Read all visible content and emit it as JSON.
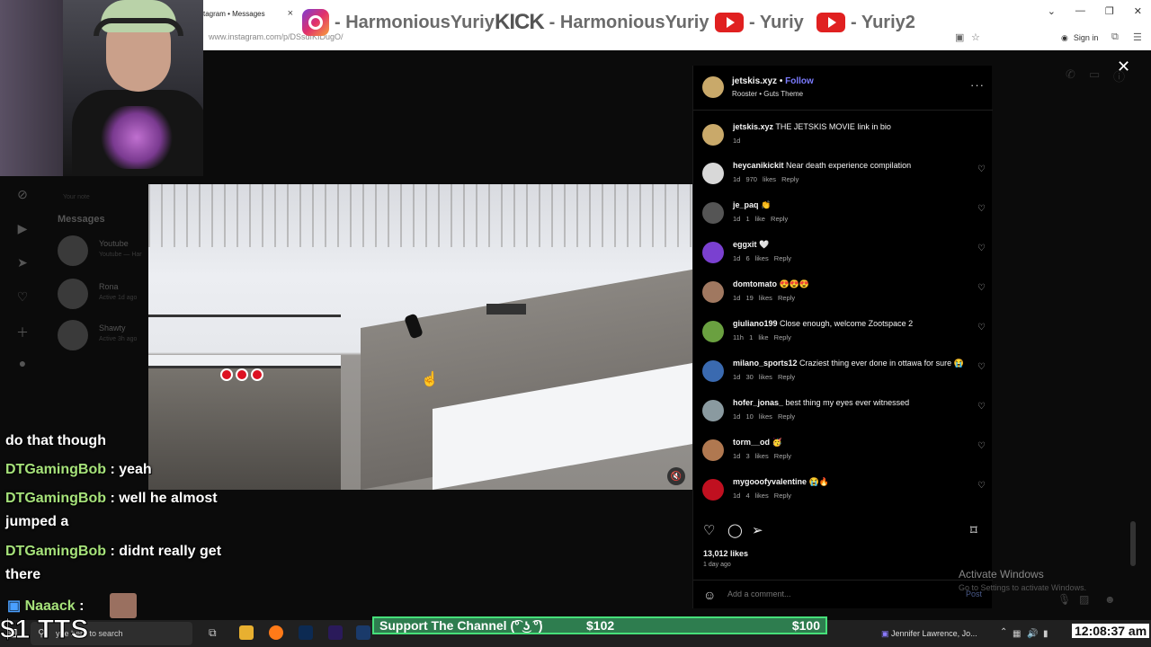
{
  "browser": {
    "tab_title": "tagram • Messages",
    "tab_close": "×",
    "url": "www.instagram.com/p/DSsdfKIDugO/",
    "sign_in": "Sign in"
  },
  "banner": {
    "items": [
      {
        "platform": "instagram",
        "text": "- HarmoniousYuriy"
      },
      {
        "platform": "kick",
        "logo": "KICK",
        "text": "- HarmoniousYuriy"
      },
      {
        "platform": "youtube",
        "text": "- Yuriy"
      },
      {
        "platform": "youtube",
        "text": "- Yuriy2"
      }
    ]
  },
  "sidebar": {
    "your_note": "Your note",
    "messages_title": "Messages",
    "conversations": [
      {
        "name": "Youtube",
        "sub": "Youtube — Har"
      },
      {
        "name": "Rona",
        "sub": "Active 1d ago"
      },
      {
        "name": "Shawty",
        "sub": "Active 3h ago"
      }
    ]
  },
  "post": {
    "username": "jetskis.xyz",
    "follow": "Follow",
    "music": "Rooster • Guts Theme",
    "more": "···",
    "likes": "13,012 likes",
    "posted": "1 day ago",
    "add_comment_placeholder": "Add a comment...",
    "post_label": "Post",
    "comments": [
      {
        "user": "jetskis.xyz",
        "text": "THE JETSKIS MOVIE link in bio",
        "time": "1d",
        "likes": "",
        "reply": "",
        "avatar_color": "#c9a96a"
      },
      {
        "user": "heycanikickit",
        "text": "Near death experience compilation",
        "time": "1d",
        "likes": "970 likes",
        "reply": "Reply",
        "avatar_color": "#d8d8d8"
      },
      {
        "user": "je_paq",
        "text": "👏",
        "time": "1d",
        "likes": "1 like",
        "reply": "Reply",
        "avatar_color": "#555555"
      },
      {
        "user": "eggxit",
        "text": "🤍",
        "time": "1d",
        "likes": "6 likes",
        "reply": "Reply",
        "avatar_color": "#7a40d0"
      },
      {
        "user": "domtomato",
        "text": "😍😍😍",
        "time": "1d",
        "likes": "19 likes",
        "reply": "Reply",
        "avatar_color": "#a07860"
      },
      {
        "user": "giuliano199",
        "text": "Close enough, welcome Zootspace 2",
        "time": "11h",
        "likes": "1 like",
        "reply": "Reply",
        "avatar_color": "#6aa040"
      },
      {
        "user": "milano_sports12",
        "text": "Craziest thing ever done in ottawa for sure 😭",
        "time": "1d",
        "likes": "30 likes",
        "reply": "Reply",
        "avatar_color": "#3a6ab0"
      },
      {
        "user": "hofer_jonas_",
        "text": "best thing my eyes ever witnessed",
        "time": "1d",
        "likes": "10 likes",
        "reply": "Reply",
        "avatar_color": "#8a9aa0"
      },
      {
        "user": "torm__od",
        "text": "🥳",
        "time": "1d",
        "likes": "3 likes",
        "reply": "Reply",
        "avatar_color": "#b07850"
      },
      {
        "user": "mygooofyvalentine",
        "text": "😭🔥",
        "time": "1d",
        "likes": "4 likes",
        "reply": "Reply",
        "avatar_color": "#c01020"
      }
    ]
  },
  "windows_notice": {
    "line1": "Activate Windows",
    "line2": "Go to Settings to activate Windows."
  },
  "chat": {
    "lines": [
      {
        "user": "",
        "text": "do that though"
      },
      {
        "user": "DTGamingBob",
        "text": " : yeah"
      },
      {
        "user": "DTGamingBob",
        "text": " : well he almost"
      },
      {
        "user": "",
        "text": "jumped a"
      },
      {
        "user": "DTGamingBob",
        "text": " : didnt really get"
      },
      {
        "user": "",
        "text": "there"
      }
    ],
    "last_user": "Naaack",
    "last_sep": ":",
    "tts": "$1 TTS"
  },
  "taskbar": {
    "search_placeholder": "ype here to search",
    "support_label": "Support The Channel (͡° ͜ʖ ͡°)",
    "support_raised": "$102",
    "support_goal": "$100",
    "media_title": "Jennifer Lawrence, Jo...",
    "clock": "12:08:37 am"
  },
  "colors": {
    "follow_blue": "#7b7bff",
    "chat_username": "#a6e27a",
    "support_green": "#46e07a"
  }
}
